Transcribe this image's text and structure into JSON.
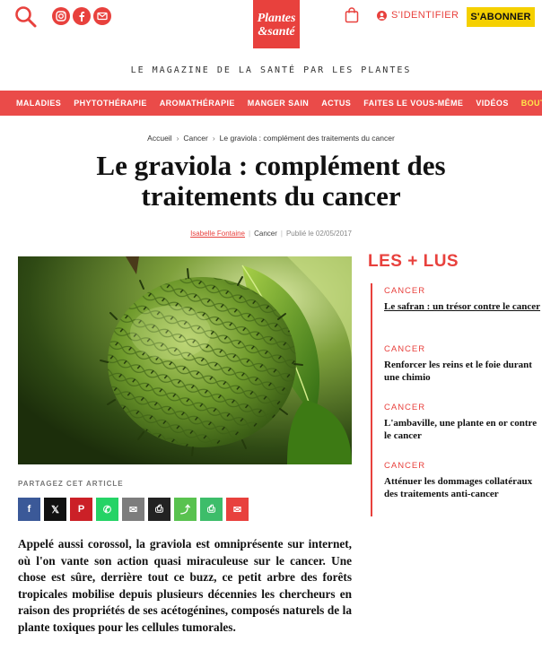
{
  "header": {
    "logo_line1": "Plantes",
    "logo_line2": "&santé",
    "signin_label": "S'IDENTIFIER",
    "subscribe_label": "S'ABONNER",
    "tagline": "LE MAGAZINE DE LA SANTÉ PAR LES PLANTES",
    "social_icons": [
      "instagram-icon",
      "facebook-icon",
      "mail-icon"
    ]
  },
  "nav": {
    "items": [
      "MALADIES",
      "PHYTOTHÉRAPIE",
      "AROMATHÉRAPIE",
      "MANGER SAIN",
      "ACTUS",
      "FAITES LE VOUS-MÊME",
      "VIDÉOS",
      "BOUTIQUE"
    ]
  },
  "breadcrumb": {
    "items": [
      "Accueil",
      "Cancer",
      "Le graviola : complément des traitements du cancer"
    ]
  },
  "article": {
    "title": "Le graviola : complément des traitements du cancer",
    "author": "Isabelle Fontaine",
    "category": "Cancer",
    "published": "Publié le 02/05/2017",
    "share_label": "PARTAGEZ CET ARTICLE",
    "lede": "Appelé aussi corossol, la graviola est omniprésente sur internet, où l'on vante son action quasi miraculeuse sur le cancer. Une chose est sûre, derrière tout ce buzz, ce petit arbre des forêts tropicales mobilise depuis plusieurs décennies les chercheurs en raison des propriétés de ses acétogénines, composés naturels de la plante toxiques pour les cellules tumorales."
  },
  "share_buttons": [
    {
      "name": "facebook-share-button",
      "glyph": "f",
      "color": "#3b5998"
    },
    {
      "name": "x-share-button",
      "glyph": "𝕏",
      "color": "#111111"
    },
    {
      "name": "pinterest-share-button",
      "glyph": "P",
      "color": "#cb2027"
    },
    {
      "name": "whatsapp-share-button",
      "glyph": "✆",
      "color": "#25d366"
    },
    {
      "name": "email-share-button",
      "glyph": "✉",
      "color": "#7d7d7d"
    },
    {
      "name": "print-share-button",
      "glyph": "⎙",
      "color": "#222222"
    },
    {
      "name": "generic-share-button",
      "glyph": "⤴",
      "color": "#59c24f"
    },
    {
      "name": "print-alt-share-button",
      "glyph": "⎙",
      "color": "#3dbd6a"
    },
    {
      "name": "email-alt-share-button",
      "glyph": "✉",
      "color": "#e8413d"
    }
  ],
  "sidebar": {
    "title": "LES + LUS",
    "items": [
      {
        "category": "CANCER",
        "title": "Le safran : un trésor contre le cancer"
      },
      {
        "category": "CANCER",
        "title": "Renforcer les reins et le foie durant une chimio"
      },
      {
        "category": "CANCER",
        "title": "L'ambaville, une plante en or contre le cancer"
      },
      {
        "category": "CANCER",
        "title": "Atténuer les dommages collatéraux des traitements anti-cancer"
      }
    ]
  },
  "colors": {
    "brand_red": "#e8413d",
    "nav_red": "#ea4b49",
    "subscribe_yellow": "#f5d000",
    "shop_yellow": "#ffe84a"
  }
}
